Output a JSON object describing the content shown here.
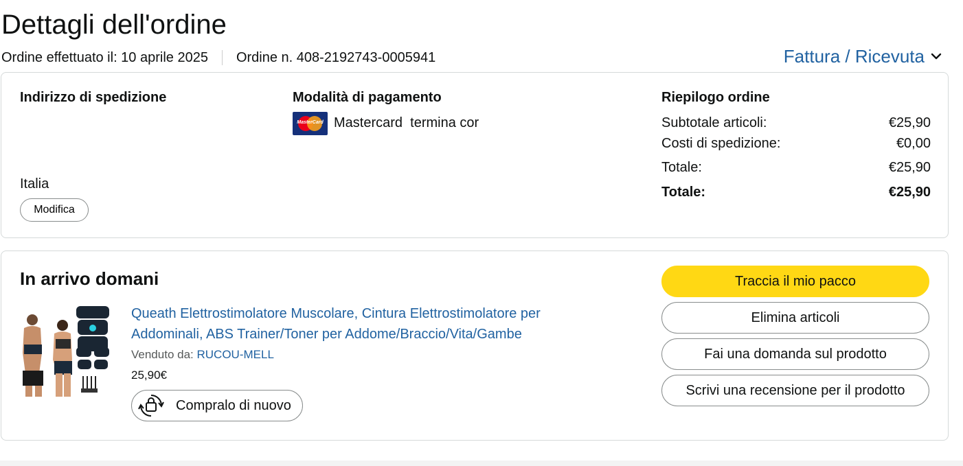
{
  "header": {
    "title": "Dettagli dell'ordine",
    "order_date": "Ordine effettuato il: 10 aprile 2025",
    "order_number": "Ordine n. 408-2192743-0005941",
    "invoice_link": "Fattura / Ricevuta"
  },
  "shipping": {
    "heading": "Indirizzo di spedizione",
    "country": "Italia",
    "edit_label": "Modifica"
  },
  "payment": {
    "heading": "Modalità di pagamento",
    "card_logo_text": "MasterCard",
    "card_text": "Mastercard  termina cor"
  },
  "summary": {
    "heading": "Riepilogo ordine",
    "rows": [
      {
        "label": "Subtotale articoli:",
        "value": "€25,90"
      },
      {
        "label": "Costi di spedizione:",
        "value": "€0,00"
      },
      {
        "label": "Totale:",
        "value": "€25,90"
      }
    ],
    "grand_total": {
      "label": "Totale:",
      "value": "€25,90"
    }
  },
  "delivery": {
    "title": "In arrivo domani",
    "product": {
      "name": "Queath Elettrostimolatore Muscolare, Cintura Elettrostimolatore per Addominali, ABS Trainer/Toner per Addome/Braccio/Vita/Gambe",
      "sold_by_label": "Venduto da:",
      "seller": "RUCOU-MELL",
      "price": "25,90€",
      "buy_again_label": "Compralo di nuovo"
    },
    "actions": [
      {
        "label": "Traccia il mio pacco",
        "style": "primary"
      },
      {
        "label": "Elimina articoli",
        "style": "secondary"
      },
      {
        "label": "Fai una domanda sul prodotto",
        "style": "secondary"
      },
      {
        "label": "Scrivi una recensione per il prodotto",
        "style": "secondary"
      }
    ]
  },
  "colors": {
    "link": "#2162a1",
    "primary_button": "#ffd814",
    "border": "#d5d9d9"
  },
  "icons": [
    "chevron-down-icon",
    "mastercard-icon",
    "buy-again-icon"
  ]
}
